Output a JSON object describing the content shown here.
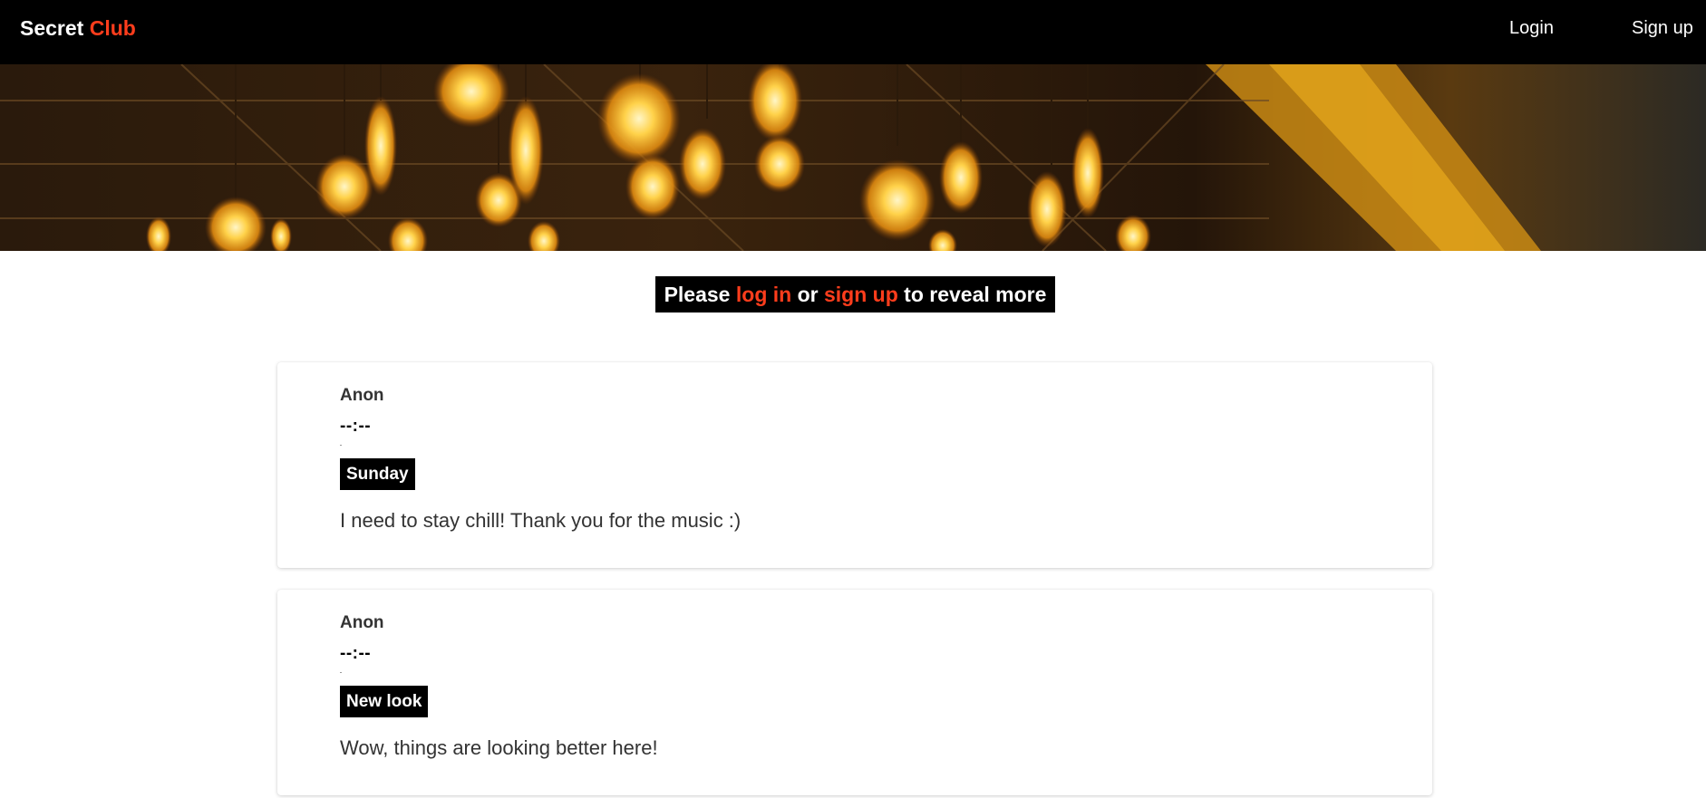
{
  "navbar": {
    "brand_first": "Secret",
    "brand_second": "Club",
    "login_label": "Login",
    "signup_label": "Sign up"
  },
  "hero": {
    "icon": "hanging-edison-bulbs-photo"
  },
  "notice": {
    "prefix": "Please",
    "login_link": "log in",
    "middle": "or",
    "signup_link": "sign up",
    "suffix": "to reveal more"
  },
  "posts": [
    {
      "author": "Anon",
      "time": "--:--",
      "title": "Sunday",
      "body": "I need to stay chill! Thank you for the music :)"
    },
    {
      "author": "Anon",
      "time": "--:--",
      "title": "New look",
      "body": "Wow, things are looking better here!"
    }
  ],
  "colors": {
    "accent": "#ff3d1c",
    "navbar_bg": "#000000",
    "text": "#333333"
  }
}
